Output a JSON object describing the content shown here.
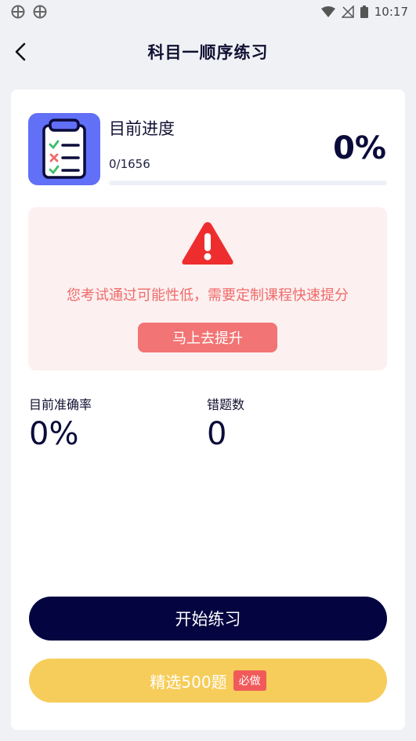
{
  "status_bar": {
    "time": "10:17"
  },
  "header": {
    "title": "科目一顺序练习"
  },
  "progress": {
    "title": "目前进度",
    "count": "0/1656",
    "percent": "0%",
    "fraction": 0
  },
  "warning": {
    "message": "您考试通过可能性低，需要定制课程快速提分",
    "button_label": "马上去提升"
  },
  "stats": {
    "accuracy_label": "目前准确率",
    "accuracy_value": "0%",
    "errors_label": "错题数",
    "errors_value": "0"
  },
  "actions": {
    "start_label": "开始练习",
    "select_label": "精选500题",
    "must_badge": "必做"
  },
  "colors": {
    "accent": "#6170f6",
    "warning": "#ef6b6b",
    "primary_button": "#030440",
    "secondary_button": "#f6cd5a"
  }
}
